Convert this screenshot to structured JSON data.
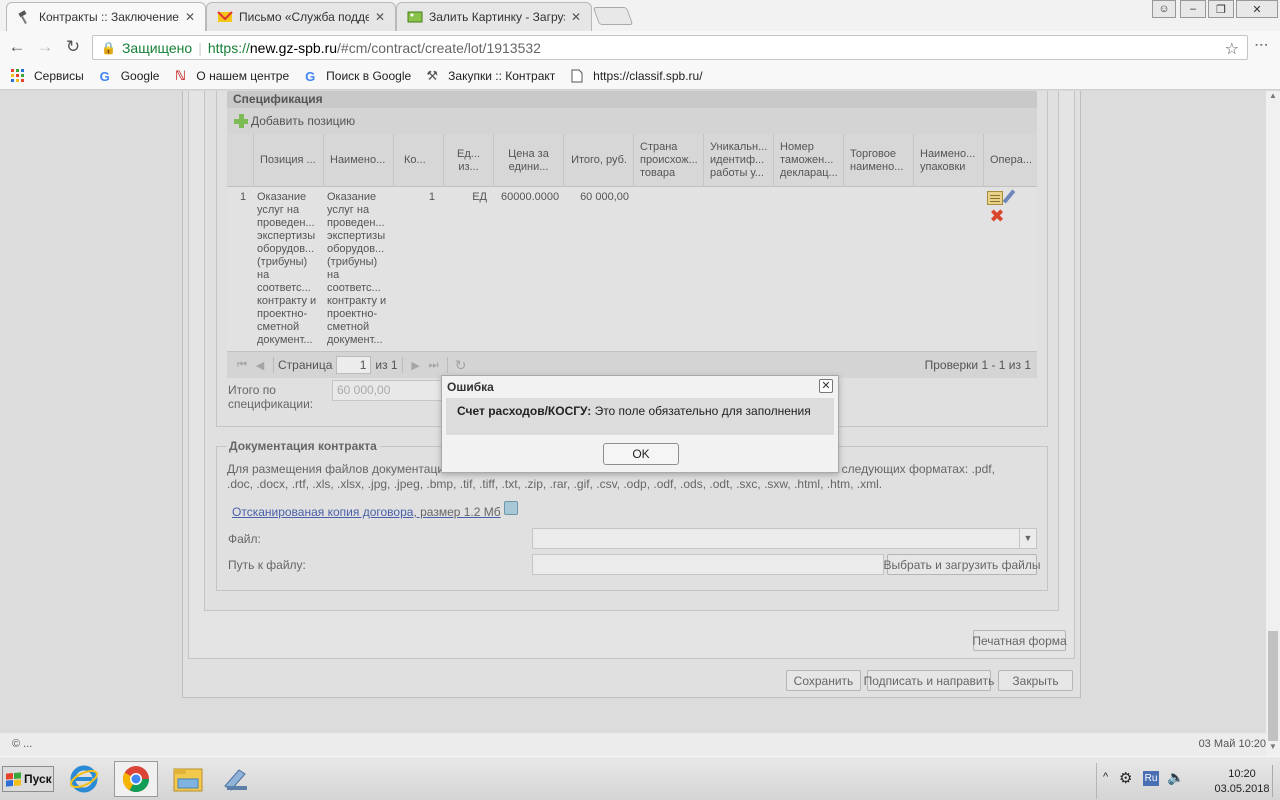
{
  "browser": {
    "tabs": [
      {
        "title": "Контракты :: Заключение",
        "active": true
      },
      {
        "title": "Письмо «Служба поддерж",
        "active": false
      },
      {
        "title": "Залить Картинку - Загрузи",
        "active": false
      }
    ],
    "address": {
      "secure_label": "Защищено",
      "scheme": "https://",
      "host": "new.gz-spb.ru",
      "path": "/#cm/contract/create/lot/1913532"
    },
    "bookmarks": [
      {
        "label": "Сервисы",
        "icon": "apps-grid-icon"
      },
      {
        "label": "Google",
        "icon": "google-icon"
      },
      {
        "label": "О нашем центре",
        "icon": "bookmark-icon"
      },
      {
        "label": "Поиск в Google",
        "icon": "google-icon"
      },
      {
        "label": "Закупки :: Контракты",
        "icon": "bookmark-icon"
      },
      {
        "label": "https://classif.spb.ru/c",
        "icon": "page-icon"
      }
    ]
  },
  "spec": {
    "title": "Спецификация",
    "add_label": "Добавить позицию",
    "columns": [
      {
        "label": "Позиция ..."
      },
      {
        "label": "Наимено..."
      },
      {
        "label": "Ко..."
      },
      {
        "label": "Ед... из..."
      },
      {
        "label": "Цена за едини..."
      },
      {
        "label": "Итого, руб."
      },
      {
        "label": "Страна происхож... товара"
      },
      {
        "label": "Уникальн... идентиф... работы у..."
      },
      {
        "label": "Номер таможен... декларац..."
      },
      {
        "label": "Торговое наимено..."
      },
      {
        "label": "Наимено... упаковки"
      },
      {
        "label": "Опера..."
      }
    ],
    "row": {
      "num": "1",
      "position": "Оказание услуг на проведен... экспертизы оборудов... (трибуны) на соответс... контракту и проектно-сметной документ...",
      "name": "Оказание услуг на проведен... экспертизы оборудов... (трибуны) на соответс... контракту и проектно-сметной документ...",
      "qty": "1",
      "unit": "ЕД",
      "price": "60000.0000",
      "total": "60 000,00"
    },
    "pager": {
      "page_label": "Страница",
      "page_value": "1",
      "of_label": "из 1",
      "summary": "Проверки 1 - 1 из 1"
    },
    "total_label": "Итого по спецификации:",
    "total_value": "60 000,00"
  },
  "docs": {
    "legend": "Документация контракта",
    "description_start": "Для размещения файлов документаци",
    "description_end": "лы в следующих форматах: .pdf,",
    "description_line2": ".doc, .docx, .rtf, .xls, .xlsx, .jpg, .jpeg, .bmp, .tif, .tiff, .txt, .zip, .rar, .gif, .csv, .odp, .odf, .ods, .odt, .sxc, .sxw, .html, .htm, .xml.",
    "scan_link": "Отсканированая копия договора",
    "scan_size": ", размер 1.2 Мб",
    "file_label": "Файл:",
    "path_label": "Путь к файлу:",
    "upload_button": "Выбрать и загрузить файлы"
  },
  "actions": {
    "print_form": "Печатная форма",
    "save": "Сохранить",
    "sign_send": "Подписать и направить",
    "close": "Закрыть"
  },
  "dialog": {
    "title": "Ошибка",
    "field_name": "Счет расходов/КОСГУ:",
    "message": "Это поле обязательно для заполнения",
    "ok": "OK"
  },
  "status": {
    "left": "© ...",
    "right": "03 Май 10:20"
  },
  "taskbar": {
    "start": "Пуск",
    "lang": "Ru",
    "time": "10:20",
    "date": "03.05.2018"
  }
}
